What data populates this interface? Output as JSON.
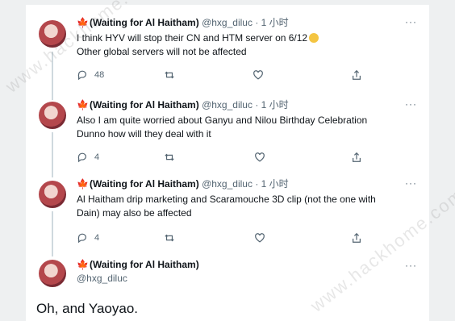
{
  "tweets": [
    {
      "leaf_icon": "maple-leaf",
      "name": "(Waiting for Al Haitham)",
      "handle": "@hxg_diluc",
      "dot": "·",
      "time": "1 小时",
      "line1": "I think HYV will stop their CN and HTM server on 6/12",
      "line2": "Other global servers will not be affected",
      "reply_count": "48",
      "more": "···"
    },
    {
      "leaf_icon": "maple-leaf",
      "name": "(Waiting for Al Haitham)",
      "handle": "@hxg_diluc",
      "dot": "·",
      "time": "1 小时",
      "line1": "Also I am quite worried about Ganyu and Nilou Birthday Celebration",
      "line2": "Dunno how will they deal with it",
      "reply_count": "4",
      "more": "···"
    },
    {
      "leaf_icon": "maple-leaf",
      "name": "(Waiting for Al Haitham)",
      "handle": "@hxg_diluc",
      "dot": "·",
      "time": "1 小时",
      "line1": "Al Haitham drip marketing and Scaramouche 3D clip (not the one with",
      "line2": "Dain) may also be affected",
      "reply_count": "4",
      "more": "···"
    }
  ],
  "main_tweet": {
    "leaf_icon": "maple-leaf",
    "name": "(Waiting for Al Haitham)",
    "handle": "@hxg_diluc",
    "text": "Oh, and Yaoyao.",
    "more": "···"
  },
  "watermark": "www.hackhome.com",
  "colors": {
    "leaf": "#d12424",
    "muted": "#536471",
    "thread": "#cfd9de"
  }
}
